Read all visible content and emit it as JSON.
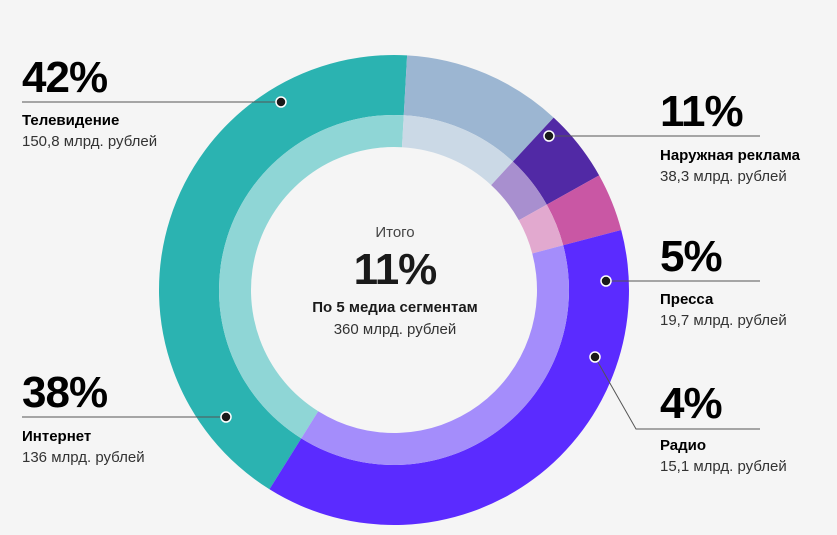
{
  "chart_data": {
    "type": "pie",
    "center": {
      "label": "Итого",
      "percent": "11%",
      "title": "По 5 медиа сегментам",
      "total": "360 млрд. рублей"
    },
    "segments": [
      {
        "key": "tv",
        "name": "Телевидение",
        "percent": 42,
        "percent_label": "42%",
        "value_label": "150,8 млрд. рублей",
        "color": "#2bb3b1",
        "inner_color": "#8fd6d6"
      },
      {
        "key": "outdoor",
        "name": "Наружная реклама",
        "percent": 11,
        "percent_label": "11%",
        "value_label": "38,3 млрд. рублей",
        "color": "#9cb6d2",
        "inner_color": "#cbd9e6"
      },
      {
        "key": "press",
        "name": "Пресса",
        "percent": 5,
        "percent_label": "5%",
        "value_label": "19,7 млрд. рублей",
        "color": "#5129a5",
        "inner_color": "#a88fcf"
      },
      {
        "key": "radio",
        "name": "Радио",
        "percent": 4,
        "percent_label": "4%",
        "value_label": "15,1 млрд. рублей",
        "color": "#c957a4",
        "inner_color": "#e2a9cf"
      },
      {
        "key": "internet",
        "name": "Интернет",
        "percent": 38,
        "percent_label": "38%",
        "value_label": "136 млрд. рублей",
        "color": "#5b2bff",
        "inner_color": "#a48dfb"
      }
    ]
  }
}
